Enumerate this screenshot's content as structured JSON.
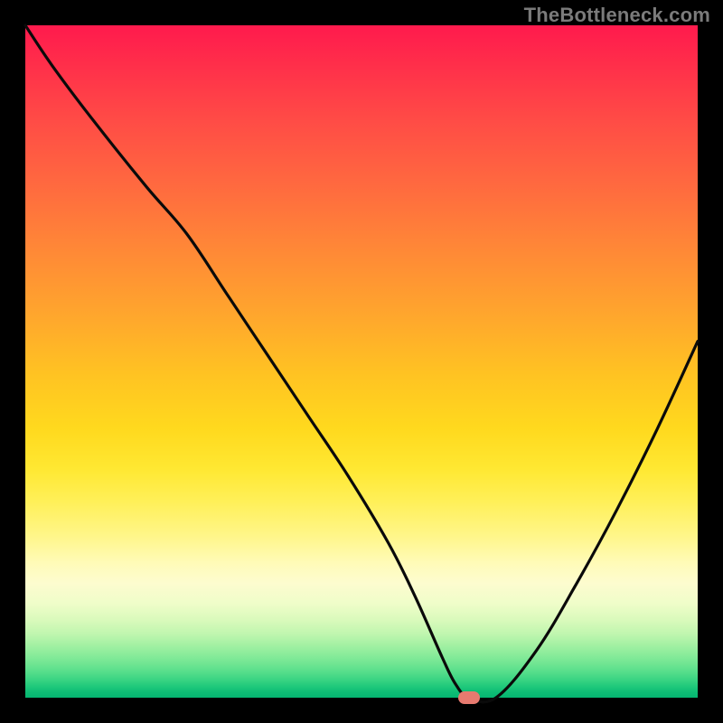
{
  "watermark": "TheBottleneck.com",
  "colors": {
    "frame_bg": "#000000",
    "curve_stroke": "#0a0a0a",
    "marker_fill": "#e77a6f",
    "watermark_text": "#7b7b7b"
  },
  "chart_data": {
    "type": "line",
    "title": "",
    "xlabel": "",
    "ylabel": "",
    "xlim": [
      0,
      100
    ],
    "ylim": [
      0,
      100
    ],
    "grid": false,
    "legend": false,
    "background_gradient": {
      "orientation": "vertical",
      "meaning": "bottleneck-severity",
      "stops": [
        {
          "pos": 0.0,
          "color": "#ff1a4d",
          "label": "high-bottleneck"
        },
        {
          "pos": 0.5,
          "color": "#ffc322",
          "label": "moderate"
        },
        {
          "pos": 0.8,
          "color": "#fffbb8",
          "label": "low"
        },
        {
          "pos": 1.0,
          "color": "#05b571",
          "label": "no-bottleneck"
        }
      ]
    },
    "series": [
      {
        "name": "bottleneck-curve",
        "x": [
          0,
          4,
          10,
          18,
          24,
          30,
          36,
          42,
          48,
          54,
          58,
          62,
          64,
          66,
          70,
          76,
          82,
          88,
          94,
          100
        ],
        "values": [
          100,
          94,
          86,
          76,
          69,
          60,
          51,
          42,
          33,
          23,
          15,
          6,
          2,
          0,
          0,
          7,
          17,
          28,
          40,
          53
        ]
      }
    ],
    "marker": {
      "name": "optimal-point",
      "x": 66,
      "y": 0,
      "shape": "pill",
      "color": "#e77a6f"
    }
  }
}
